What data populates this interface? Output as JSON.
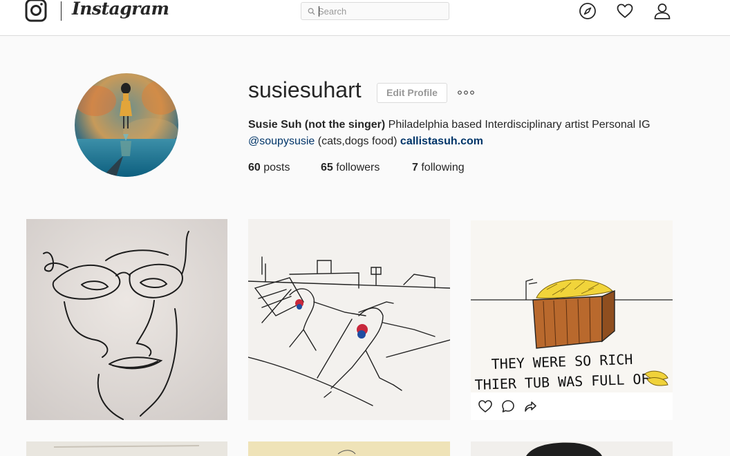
{
  "nav": {
    "brand": "Instagram",
    "search_placeholder": "Search",
    "icons": [
      "instagram-logo-icon",
      "search-icon",
      "explore-compass-icon",
      "heart-icon",
      "profile-person-icon"
    ]
  },
  "profile": {
    "username": "susiesuhart",
    "edit_button": "Edit Profile",
    "more_icon": "more-options-icon",
    "full_name": "Susie Suh (not the singer)",
    "bio_text": " Philadelphia based Interdisciplinary artist Personal IG",
    "bio_mention": "@soupysusie",
    "bio_tail": " (cats,dogs food) ",
    "website": "callistasuh.com",
    "stats": {
      "posts_count": "60",
      "posts_label": " posts",
      "followers_count": "65",
      "followers_label": " followers",
      "following_count": "7",
      "following_label": " following"
    }
  },
  "posts": {
    "tile3_caption_line1": "THEY WERE SO RICH",
    "tile3_caption_line2": "THIER TUB WAS FULL OF",
    "hover_actions": [
      "like-heart-icon",
      "comment-bubble-icon",
      "share-arrow-icon"
    ]
  },
  "colors": {
    "link": "#003569",
    "border": "#dbdbdb",
    "background": "#fafafa"
  }
}
